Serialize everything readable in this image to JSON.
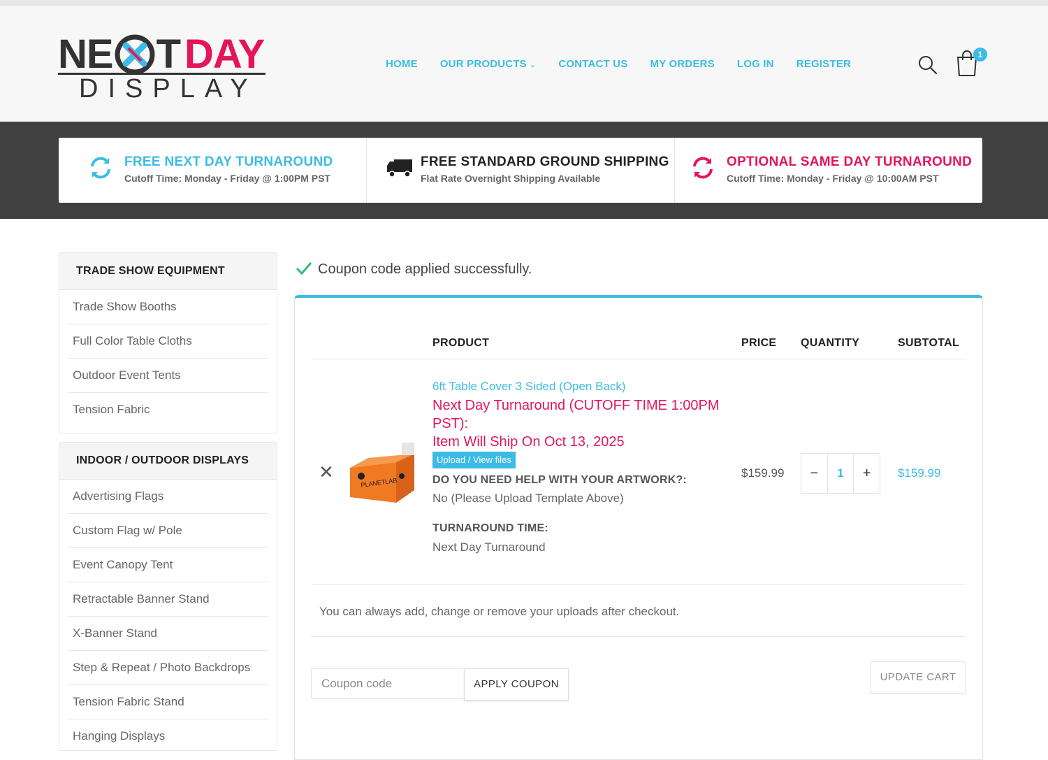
{
  "logo": {
    "word1": "NE",
    "word1b": "T",
    "word2": "DAY",
    "word3": "DISPLAY"
  },
  "nav": {
    "home": "HOME",
    "products": "OUR PRODUCTS",
    "contact": "CONTACT US",
    "orders": "MY ORDERS",
    "login": "LOG IN",
    "register": "REGISTER"
  },
  "cart": {
    "count": "1"
  },
  "banner": [
    {
      "title": "FREE NEXT DAY TURNAROUND",
      "subtitle": "Cutoff Time: Monday - Friday @ 1:00PM PST"
    },
    {
      "title": "FREE STANDARD GROUND SHIPPING",
      "subtitle": "Flat Rate Overnight Shipping Available"
    },
    {
      "title": "OPTIONAL SAME DAY TURNAROUND",
      "subtitle": "Cutoff Time: Monday - Friday @ 10:00AM PST"
    }
  ],
  "sidebar": {
    "section1": {
      "title": "TRADE SHOW EQUIPMENT",
      "items": [
        "Trade Show Booths",
        "Full Color Table Cloths",
        "Outdoor Event Tents",
        "Tension Fabric"
      ]
    },
    "section2": {
      "title": "INDOOR / OUTDOOR DISPLAYS",
      "items": [
        "Advertising Flags",
        "Custom Flag w/ Pole",
        "Event Canopy Tent",
        "Retractable Banner Stand",
        "X-Banner Stand",
        "Step & Repeat / Photo Backdrops",
        "Tension Fabric Stand",
        "Hanging Displays"
      ]
    }
  },
  "notice": "Coupon code applied successfully.",
  "table": {
    "headers": {
      "product": "PRODUCT",
      "price": "PRICE",
      "quantity": "QUANTITY",
      "subtotal": "SUBTOTAL"
    },
    "item": {
      "name": "6ft Table Cover 3 Sided (Open Back)",
      "note_line1": "Next Day Turnaround (CUTOFF TIME 1:00PM PST):",
      "note_line2": "Item Will Ship On Oct 13, 2025",
      "upload_label": "Upload / View files",
      "artwork_label": "DO YOU NEED HELP WITH YOUR ARTWORK?:",
      "artwork_value": "No (Please Upload Template Above)",
      "turnaround_label": "TURNAROUND TIME:",
      "turnaround_value": "Next Day Turnaround",
      "price": "$159.99",
      "quantity": "1",
      "subtotal": "$159.99",
      "remove": "✕",
      "minus": "−",
      "plus": "+"
    }
  },
  "uploads_note": "You can always add, change or remove your uploads after checkout.",
  "coupon": {
    "placeholder": "Coupon code",
    "apply_label": "APPLY COUPON",
    "update_label": "UPDATE CART"
  },
  "colors": {
    "accent": "#3cbce4",
    "brand_pink": "#e5155a",
    "banner_bg": "#404040"
  }
}
